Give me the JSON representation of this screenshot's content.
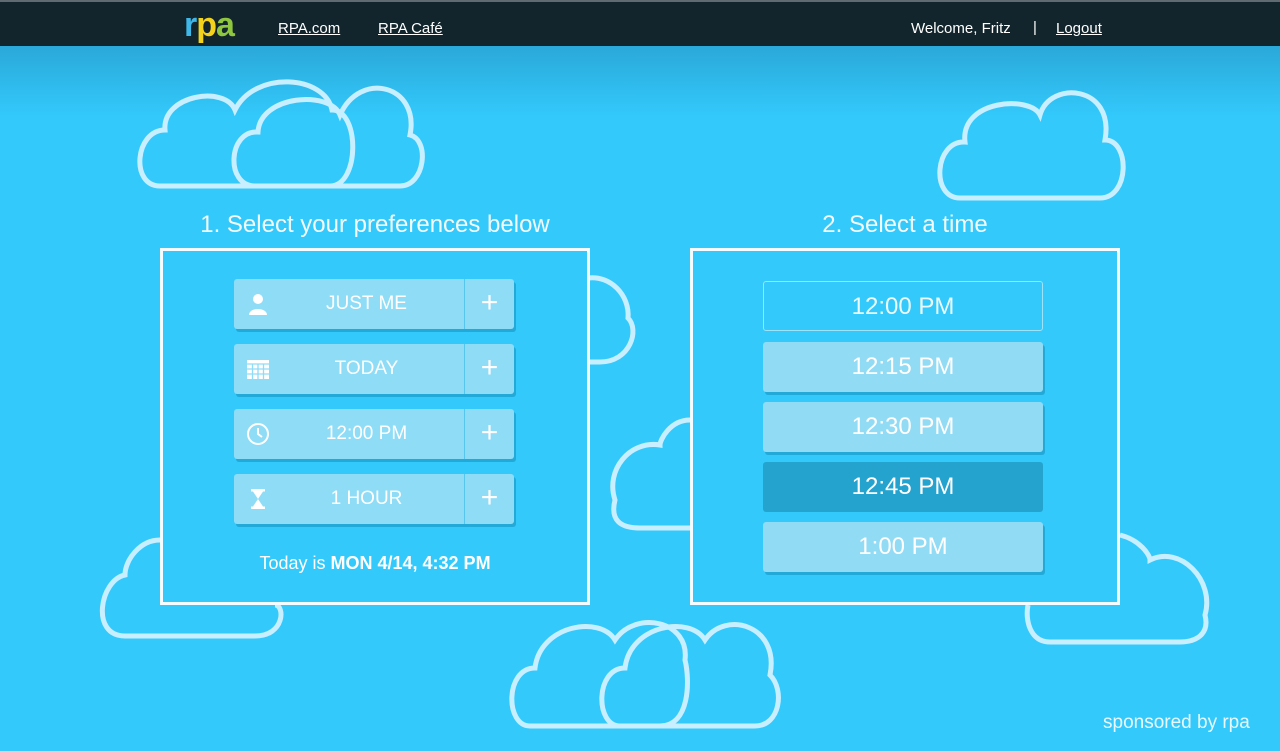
{
  "header": {
    "logo_text": "rpa",
    "links": [
      "RPA.com",
      "RPA Café"
    ],
    "welcome": "Welcome, Fritz",
    "separator": "|",
    "logout": "Logout"
  },
  "preferences": {
    "title": "1. Select your preferences below",
    "rows": [
      {
        "icon": "person-icon",
        "label": "JUST ME"
      },
      {
        "icon": "calendar-icon",
        "label": "TODAY"
      },
      {
        "icon": "clock-icon",
        "label": "12:00 PM"
      },
      {
        "icon": "hourglass-icon",
        "label": "1 HOUR"
      }
    ],
    "plus": "+",
    "today_prefix": "Today is",
    "today_value": "MON 4/14, 4:32 PM"
  },
  "times": {
    "title": "2. Select a time",
    "slots": [
      {
        "label": "12:00 PM",
        "state": "outlined"
      },
      {
        "label": "12:15 PM",
        "state": "normal"
      },
      {
        "label": "12:30 PM",
        "state": "normal"
      },
      {
        "label": "12:45 PM",
        "state": "selected"
      },
      {
        "label": "1:00 PM",
        "state": "normal"
      }
    ]
  },
  "footer": {
    "sponsor": "sponsored by rpa"
  },
  "colors": {
    "background": "#33c9fb",
    "topbar": "#13252c",
    "button": "#8fdcf7",
    "selected": "#25a3cf"
  }
}
